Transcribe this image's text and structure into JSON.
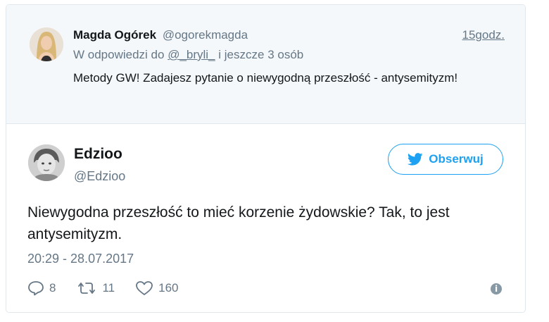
{
  "parent_tweet": {
    "author_name": "Magda Ogórek",
    "author_handle": "@ogorekmagda",
    "time": "15godz.",
    "reply_prefix": "W odpowiedzi do",
    "reply_to": "@_bryli_",
    "reply_suffix": "i jeszcze 3 osób",
    "text": "Metody GW! Zadajesz pytanie o niewygodną przeszłość - antysemityzm!"
  },
  "tweet": {
    "author_name": "Edzioo",
    "author_handle": "@Edzioo",
    "follow_label": "Obserwuj",
    "text": "Niewygodna przeszłość to mieć korzenie żydowskie? Tak, to jest antysemityzm.",
    "date": "20:29 - 28.07.2017",
    "replies": "8",
    "retweets": "11",
    "likes": "160",
    "info_icon": "info-icon"
  },
  "colors": {
    "accent": "#1da1f2",
    "muted": "#657786",
    "parent_bg": "#f5f8fa",
    "border": "#e1e8ed"
  }
}
